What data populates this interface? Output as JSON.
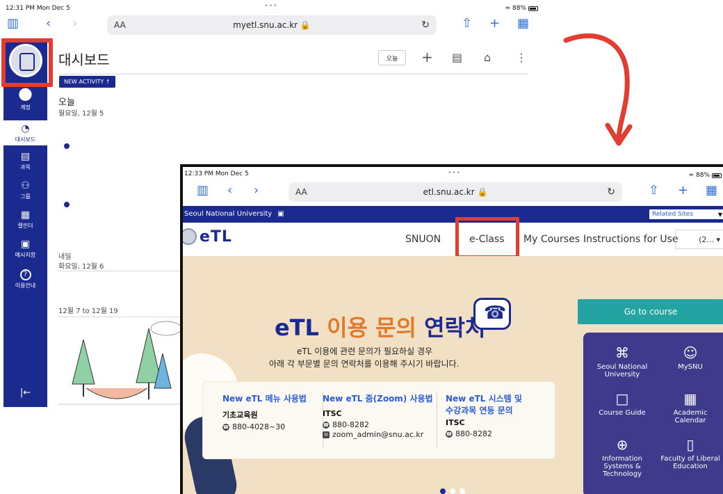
{
  "back": {
    "statusbar": {
      "time": "12:31 PM  Mon Dec 5",
      "dots": "•••",
      "battery": "88%"
    },
    "url": "myetl.snu.ac.kr 🔒",
    "aa": "AA",
    "sidebar": {
      "items": [
        {
          "label": "계정",
          "glyph": "●"
        },
        {
          "label": "대시보드",
          "glyph": "◔"
        },
        {
          "label": "과목",
          "glyph": "▤"
        },
        {
          "label": "그룹",
          "glyph": "⚇"
        },
        {
          "label": "캘린더",
          "glyph": "▦"
        },
        {
          "label": "메시지함",
          "glyph": "▣"
        },
        {
          "label": "이용안내",
          "glyph": "?"
        }
      ],
      "collapse_glyph": "|←"
    },
    "page_title": "대시보드",
    "today_button": "오늘",
    "new_activity": "NEW ACTIVITY ↑",
    "today_label": "오늘",
    "today_date": "월요일, 12월 5",
    "tomorrow_label": "내일",
    "tomorrow_date": "화요일, 12월 6",
    "range_label": "12월 7 to 12월 19"
  },
  "front": {
    "statusbar": {
      "time": "12:33 PM  Mon Dec 5",
      "dots": "•••",
      "battery": "88%"
    },
    "url": "etl.snu.ac.kr 🔒",
    "aa": "AA",
    "strip_label": "Seoul National University",
    "related_sites": "Related Sites",
    "logo_text": "eTL",
    "nav": {
      "snuon": "SNUON",
      "eclass": "e-Class",
      "my_courses": "My Courses",
      "instructions": "Instructions for Use",
      "lang": "(2... ▾"
    },
    "hero": {
      "title_1": "eTL ",
      "title_2": "이용 문의 ",
      "title_3": "연락처",
      "line1": "eTL 이용에 관련 문의가 필요하실 경우",
      "line2": "아래 각 부문별 문의 연락처를 이용해 주시기 바랍니다."
    },
    "contacts": [
      {
        "title": "New eTL 메뉴 사용법",
        "org": "기초교육원",
        "phone": "880-4028~30"
      },
      {
        "title": "New eTL 줌(Zoom) 사용법",
        "org": "ITSC",
        "phone": "880-8282",
        "email": "zoom_admin@snu.ac.kr"
      },
      {
        "title_1": "New eTL 시스템 및",
        "title_2": "수강과목 연동 문의",
        "org": "ITSC",
        "phone": "880-8282"
      }
    ],
    "goto_course": "Go to course",
    "quick_links": [
      {
        "label": "Seoul National University",
        "glyph": "⌘"
      },
      {
        "label": "MySNU",
        "glyph": "☺"
      },
      {
        "label": "Course Guide",
        "glyph": "□"
      },
      {
        "label": "Academic Calendar",
        "glyph": "▦"
      },
      {
        "label": "Information Systems & Technology",
        "glyph": "⊕"
      },
      {
        "label": "Faculty of Liberal Education",
        "glyph": "▯"
      }
    ]
  },
  "colors": {
    "brand_blue": "#1b2a8f",
    "highlight_red": "#e23d30",
    "teal": "#24a3a3",
    "hero_bg": "#f1e0c4"
  }
}
